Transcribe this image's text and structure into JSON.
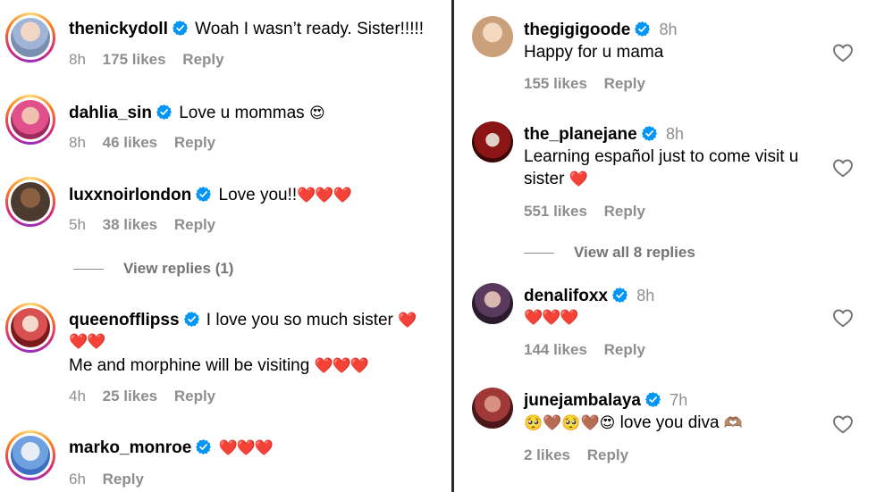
{
  "left": {
    "comments": [
      {
        "username": "thenickydoll",
        "text": "Woah I wasn’t ready. Sister!!!!!",
        "time": "8h",
        "likes": "175 likes",
        "reply": "Reply",
        "avatar_color": "#7a8fb0"
      },
      {
        "username": "dahlia_sin",
        "text": "Love u mommas",
        "emoji": "😍",
        "time": "8h",
        "likes": "46 likes",
        "reply": "Reply",
        "avatar_color": "#c0457e"
      },
      {
        "username": "luxxnoirlondon",
        "text": "Love you!!",
        "hearts": "❤️❤️❤️",
        "time": "5h",
        "likes": "38 likes",
        "reply": "Reply",
        "avatar_color": "#4a3a30"
      },
      {
        "username": "queenofflipss",
        "text": "I love you so much sister",
        "hearts1": "❤️",
        "hearts2": "❤️❤️",
        "text2": "Me and morphine will be visiting",
        "hearts3": "❤️❤️❤️",
        "time": "4h",
        "likes": "25 likes",
        "reply": "Reply",
        "avatar_color": "#b5373a"
      },
      {
        "username": "marko_monroe",
        "hearts": "❤️❤️❤️",
        "time": "6h",
        "reply": "Reply",
        "avatar_color": "#3d6fc2"
      }
    ],
    "view_replies": "View replies (1)"
  },
  "right": {
    "comments": [
      {
        "username": "thegigigoode",
        "time": "8h",
        "text": "Happy for u mama",
        "likes": "155 likes",
        "reply": "Reply",
        "avatar_color": "#c9a07a"
      },
      {
        "username": "the_planejane",
        "time": "8h",
        "text": "Learning español just to come visit u",
        "text2": "sister",
        "hearts": "❤️",
        "likes": "551 likes",
        "reply": "Reply",
        "avatar_color": "#5a1010"
      },
      {
        "username": "denalifoxx",
        "time": "8h",
        "hearts": "❤️❤️❤️",
        "likes": "144 likes",
        "reply": "Reply",
        "avatar_color": "#3a2a3c"
      },
      {
        "username": "junejambalaya",
        "time": "7h",
        "emoji_text": "🥺🤎🥺🤎😍",
        "text": "love you diva",
        "emoji_end": "🫶🏽",
        "likes": "2 likes",
        "reply": "Reply",
        "avatar_color": "#5a2b2b"
      }
    ],
    "view_all": "View all 8 replies"
  },
  "colors": {
    "verified": "#0095f6",
    "muted": "#8e8e8e",
    "heart": "#ff2d3f"
  }
}
